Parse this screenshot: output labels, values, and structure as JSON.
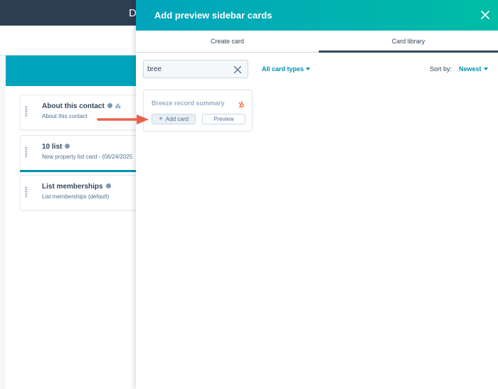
{
  "background": {
    "topbar_letter": "D",
    "cards": [
      {
        "title": "About this contact",
        "subtitle": "About this contact",
        "has_extra_icon": true
      },
      {
        "title": "10 list",
        "subtitle": "New property list card - (06/24/2025"
      },
      {
        "title": "List memberships",
        "subtitle": "List memberships (default)"
      }
    ]
  },
  "panel": {
    "title": "Add preview sidebar cards",
    "close_icon": "close-icon",
    "tabs": [
      {
        "label": "Create card",
        "active": false
      },
      {
        "label": "Card library",
        "active": true
      }
    ],
    "search": {
      "value": "bree",
      "placeholder": ""
    },
    "filter": {
      "label": "All card types"
    },
    "sort": {
      "label": "Sort by:",
      "value": "Newest"
    },
    "results": [
      {
        "title": "Breeze record summary",
        "icon": "hubspot-sprocket-icon",
        "add_label": "Add card",
        "preview_label": "Preview"
      }
    ]
  },
  "colors": {
    "header_start": "#00a4bd",
    "header_end": "#00bda5",
    "link": "#0091ae",
    "arrow": "#e8604c",
    "topbar": "#2d3e50"
  }
}
